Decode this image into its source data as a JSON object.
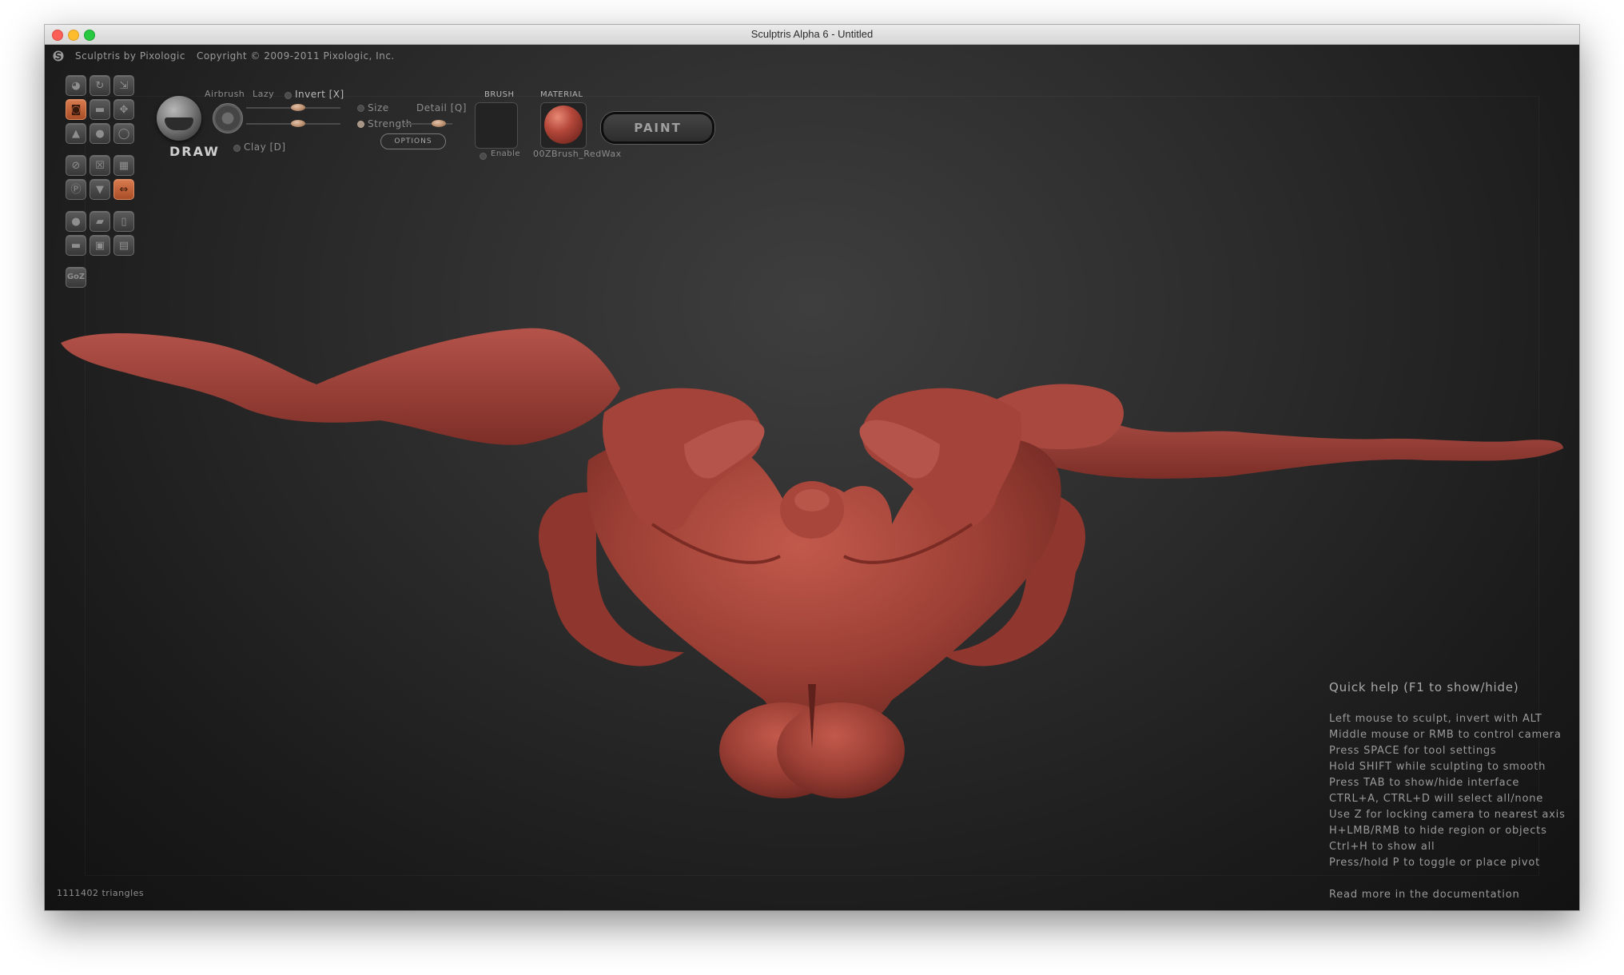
{
  "window": {
    "title": "Sculptris Alpha 6 - Untitled"
  },
  "info_bar": {
    "app_name": "Sculptris by Pixologic",
    "copyright": "Copyright © 2009-2011 Pixologic, Inc."
  },
  "toolbar": {
    "tools": [
      [
        "crease-tool",
        "rotate-tool",
        "scale-tool"
      ],
      [
        "draw-tool",
        "flatten-tool",
        "grab-tool"
      ],
      [
        "pinch-tool",
        "inflate-tool",
        "smooth-tool"
      ],
      [
        "reduce-brush",
        "reduce-selection",
        "wireframe-toggle"
      ],
      [
        "symmetry-toggle",
        "mask-tool",
        "mirror-toggle"
      ],
      [
        "sphere-primitive",
        "import-object",
        "export-object"
      ],
      [
        "plane-primitive",
        "save-file",
        "open-file"
      ]
    ],
    "active_tools": [
      "draw-tool",
      "mirror-toggle"
    ],
    "goz_label": "GoZ"
  },
  "brush_panel": {
    "name": "DRAW",
    "airbrush_label": "Airbrush",
    "lazy_label": "Lazy",
    "invert_label": "Invert [X]",
    "size_label": "Size",
    "detail_label": "Detail [Q]",
    "strength_label": "Strength",
    "options_label": "OPTIONS",
    "clay_label": "Clay [D]",
    "brush_header": "BRUSH",
    "material_header": "MATERIAL",
    "enable_label": "Enable",
    "material_name": "00ZBrush_RedWax",
    "paint_label": "PAINT"
  },
  "quick_help": {
    "title": "Quick help (F1 to show/hide)",
    "lines": [
      "Left mouse to sculpt, invert with ALT",
      "Middle mouse or RMB to control camera",
      "Press SPACE for tool settings",
      "Hold SHIFT while sculpting to smooth",
      "Press TAB to show/hide interface",
      "CTRL+A, CTRL+D will select all/none",
      "Use Z for locking camera to nearest axis",
      "H+LMB/RMB to hide region or objects",
      "Ctrl+H to show all",
      "Press/hold P to toggle or place pivot"
    ],
    "more": "Read more in the documentation"
  },
  "status": {
    "triangles": "1111402 triangles"
  },
  "colors": {
    "accent_active": "#c4683e",
    "material_red": "#a8473d",
    "background": "#1c1c1c"
  }
}
